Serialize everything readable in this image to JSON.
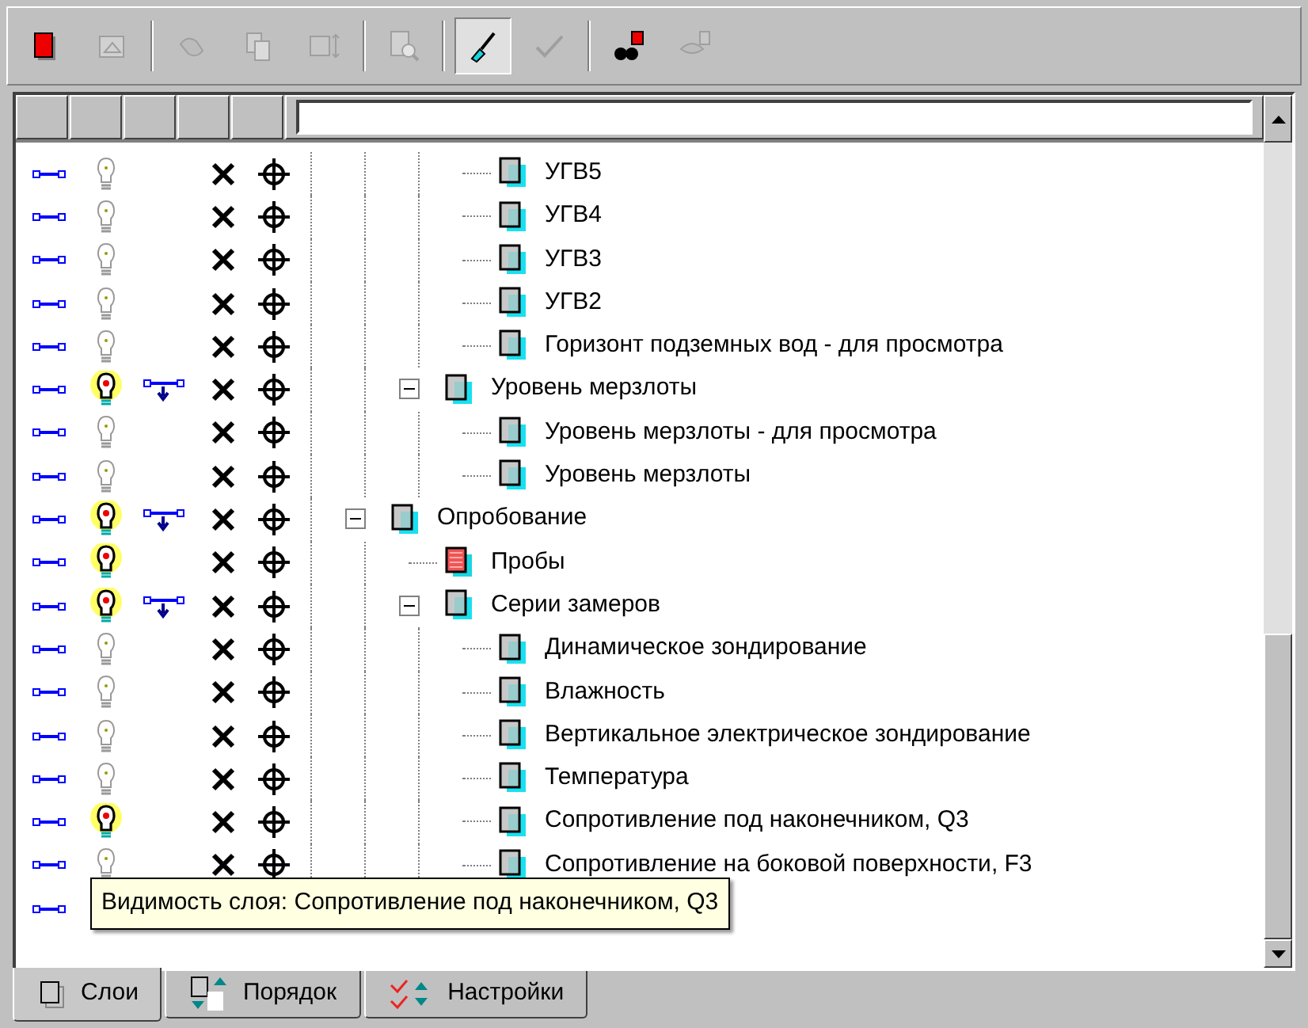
{
  "toolbar": [
    {
      "kind": "layer-red",
      "disabled": false,
      "pressed": false
    },
    {
      "kind": "properties",
      "disabled": true,
      "pressed": false
    },
    {
      "kind": "separator"
    },
    {
      "kind": "hand",
      "disabled": true,
      "pressed": false
    },
    {
      "kind": "copy",
      "disabled": true,
      "pressed": false
    },
    {
      "kind": "resize",
      "disabled": true,
      "pressed": false
    },
    {
      "kind": "separator"
    },
    {
      "kind": "preview",
      "disabled": true,
      "pressed": false
    },
    {
      "kind": "separator"
    },
    {
      "kind": "brush",
      "disabled": false,
      "pressed": true
    },
    {
      "kind": "check",
      "disabled": true,
      "pressed": false
    },
    {
      "kind": "separator"
    },
    {
      "kind": "binoculars",
      "disabled": false,
      "pressed": false
    },
    {
      "kind": "eye",
      "disabled": true,
      "pressed": false
    }
  ],
  "tree": [
    {
      "children": [
        {
          "children": [
            {
              "label": "УГВ5",
              "kind": "layer",
              "visible": false,
              "linked": false
            },
            {
              "label": "УГВ4",
              "kind": "layer",
              "visible": false,
              "linked": false
            },
            {
              "label": "УГВ3",
              "kind": "layer",
              "visible": false,
              "linked": false
            },
            {
              "label": "УГВ2",
              "kind": "layer",
              "visible": false,
              "linked": false
            },
            {
              "label": "Горизонт подземных вод - для просмотра",
              "kind": "layer",
              "visible": false,
              "linked": false
            }
          ]
        },
        {
          "label": "Уровень мерзлоты",
          "kind": "layer",
          "visible": true,
          "linked": true,
          "expanded": true,
          "children": [
            {
              "label": "Уровень мерзлоты - для просмотра",
              "kind": "layer",
              "visible": false,
              "linked": false
            },
            {
              "label": "Уровень мерзлоты",
              "kind": "layer",
              "visible": false,
              "linked": false
            }
          ]
        }
      ]
    },
    {
      "label": "Опробование",
      "kind": "layer",
      "visible": true,
      "linked": true,
      "expanded": true,
      "children": [
        {
          "label": "Пробы",
          "kind": "sample",
          "visible": true,
          "linked": false
        },
        {
          "label": "Серии замеров",
          "kind": "layer",
          "visible": true,
          "linked": true,
          "expanded": true,
          "children": [
            {
              "label": "Динамическое зондирование",
              "kind": "layer",
              "visible": false,
              "linked": false
            },
            {
              "label": "Влажность",
              "kind": "layer",
              "visible": false,
              "linked": false
            },
            {
              "label": "Вертикальное электрическое зондирование",
              "kind": "layer",
              "visible": false,
              "linked": false
            },
            {
              "label": "Температура",
              "kind": "layer",
              "visible": false,
              "linked": false
            },
            {
              "label": "Сопротивление под наконечником, Q3",
              "kind": "layer",
              "visible": true,
              "linked": false
            },
            {
              "label": "Сопротивление на боковой поверхности, F3",
              "kind": "layer",
              "visible": false,
              "linked": false
            },
            {
              "kind": "layer"
            }
          ]
        }
      ]
    }
  ],
  "tooltip": {
    "text": "Видимость слоя: Сопротивление под наконечником, Q3"
  },
  "tabs": [
    {
      "label": "Слои",
      "kind": "layers",
      "selected": true
    },
    {
      "label": "Порядок",
      "kind": "order",
      "selected": false
    },
    {
      "label": "Настройки",
      "kind": "settings",
      "selected": false
    }
  ]
}
